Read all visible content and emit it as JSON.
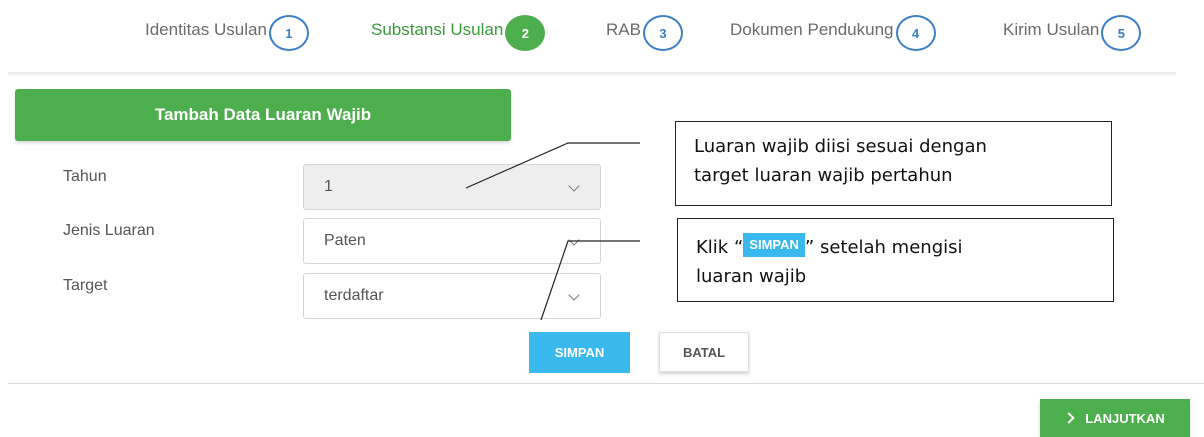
{
  "stepper": {
    "steps": [
      {
        "label": "Identitas Usulan",
        "number": "1",
        "active": false
      },
      {
        "label": "Substansi Usulan",
        "number": "2",
        "active": true
      },
      {
        "label": "RAB",
        "number": "3",
        "active": false
      },
      {
        "label": "Dokumen Pendukung",
        "number": "4",
        "active": false
      },
      {
        "label": "Kirim Usulan",
        "number": "5",
        "active": false
      }
    ]
  },
  "panel": {
    "title": "Tambah Data Luaran Wajib"
  },
  "form": {
    "tahun": {
      "label": "Tahun",
      "value": "1",
      "disabled": true
    },
    "jenis": {
      "label": "Jenis Luaran",
      "value": "Paten"
    },
    "target": {
      "label": "Target",
      "value": "terdaftar"
    }
  },
  "buttons": {
    "simpan": "SIMPAN",
    "batal": "BATAL",
    "lanjutkan": "LANJUTKAN"
  },
  "callouts": {
    "c1_line1": "Luaran wajib diisi sesuai dengan",
    "c1_line2": "target luaran wajib pertahun",
    "c2_pre": "Klik “",
    "c2_button": "SIMPAN",
    "c2_post": "” setelah mengisi",
    "c2_line2": "luaran wajib"
  },
  "colors": {
    "green": "#4cae4c",
    "blue": "#3ab9ee",
    "step_blue": "#3b7fc4"
  }
}
